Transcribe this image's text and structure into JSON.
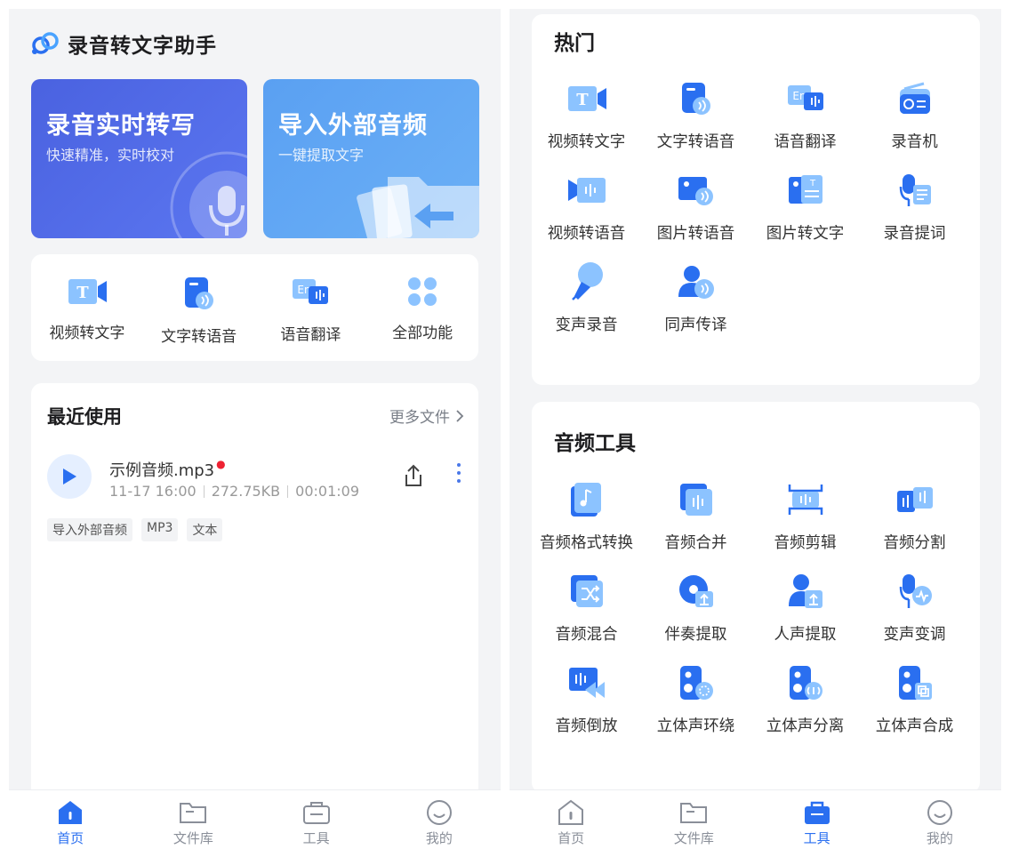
{
  "home": {
    "app_title": "录音转文字助手",
    "banners": [
      {
        "title": "录音实时转写",
        "subtitle": "快速精准，实时校对"
      },
      {
        "title": "导入外部音频",
        "subtitle": "一键提取文字"
      }
    ],
    "quick": [
      {
        "label": "视频转文字",
        "icon": "video-to-text-icon"
      },
      {
        "label": "文字转语音",
        "icon": "text-to-speech-icon"
      },
      {
        "label": "语音翻译",
        "icon": "voice-translate-icon"
      },
      {
        "label": "全部功能",
        "icon": "all-functions-icon"
      }
    ],
    "recent": {
      "title": "最近使用",
      "more": "更多文件",
      "file": {
        "name": "示例音频.mp3",
        "date": "11-17 16:00",
        "size": "272.75KB",
        "duration": "00:01:09",
        "tags": [
          "导入外部音频",
          "MP3",
          "文本"
        ]
      }
    }
  },
  "tabs": [
    {
      "label": "首页",
      "icon": "home-icon"
    },
    {
      "label": "文件库",
      "icon": "folder-icon"
    },
    {
      "label": "工具",
      "icon": "toolbox-icon"
    },
    {
      "label": "我的",
      "icon": "profile-icon"
    }
  ],
  "tools": {
    "hot": {
      "title": "热门",
      "items": [
        {
          "label": "视频转文字",
          "icon": "video-to-text-icon"
        },
        {
          "label": "文字转语音",
          "icon": "text-to-speech-icon"
        },
        {
          "label": "语音翻译",
          "icon": "voice-translate-icon"
        },
        {
          "label": "录音机",
          "icon": "recorder-icon"
        },
        {
          "label": "视频转语音",
          "icon": "video-to-audio-icon"
        },
        {
          "label": "图片转语音",
          "icon": "image-to-speech-icon"
        },
        {
          "label": "图片转文字",
          "icon": "image-to-text-icon"
        },
        {
          "label": "录音提词",
          "icon": "teleprompter-icon"
        },
        {
          "label": "变声录音",
          "icon": "voice-change-record-icon"
        },
        {
          "label": "同声传译",
          "icon": "simultaneous-interpret-icon"
        }
      ]
    },
    "audio": {
      "title": "音频工具",
      "items": [
        {
          "label": "音频格式转换",
          "icon": "audio-format-convert-icon"
        },
        {
          "label": "音频合并",
          "icon": "audio-merge-icon"
        },
        {
          "label": "音频剪辑",
          "icon": "audio-cut-icon"
        },
        {
          "label": "音频分割",
          "icon": "audio-split-icon"
        },
        {
          "label": "音频混合",
          "icon": "audio-mix-icon"
        },
        {
          "label": "伴奏提取",
          "icon": "accompaniment-extract-icon"
        },
        {
          "label": "人声提取",
          "icon": "vocal-extract-icon"
        },
        {
          "label": "变声变调",
          "icon": "pitch-change-icon"
        },
        {
          "label": "音频倒放",
          "icon": "audio-reverse-icon"
        },
        {
          "label": "立体声环绕",
          "icon": "stereo-surround-icon"
        },
        {
          "label": "立体声分离",
          "icon": "stereo-separate-icon"
        },
        {
          "label": "立体声合成",
          "icon": "stereo-synthesize-icon"
        }
      ]
    }
  },
  "colors": {
    "primary": "#2a6ff0",
    "banner1": "#4a62e0",
    "banner2": "#5aa0f2"
  }
}
